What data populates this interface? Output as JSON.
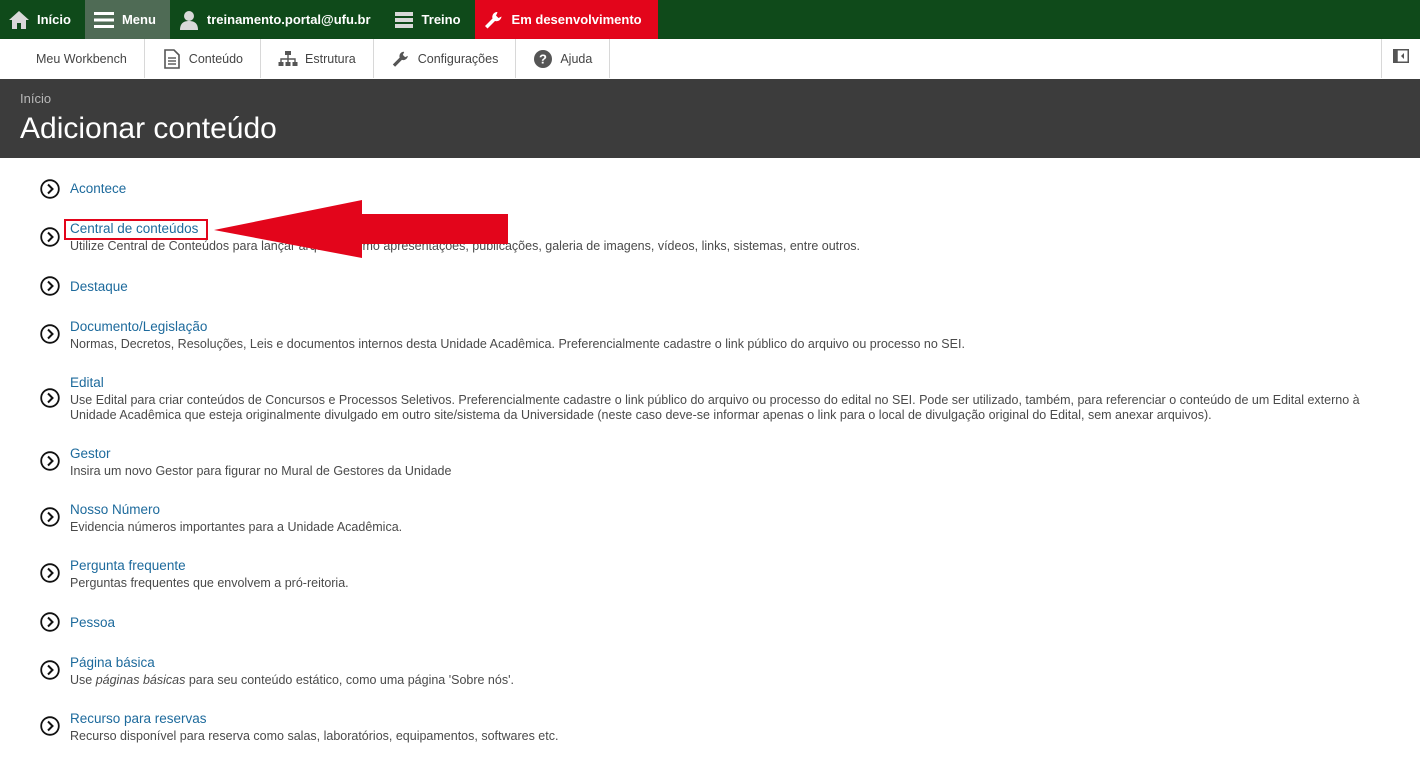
{
  "toolbar": {
    "home": "Início",
    "menu": "Menu",
    "user": "treinamento.portal@ufu.br",
    "treino": "Treino",
    "dev": "Em desenvolvimento"
  },
  "tray": {
    "workbench": "Meu Workbench",
    "content": "Conteúdo",
    "structure": "Estrutura",
    "config": "Configurações",
    "help": "Ajuda"
  },
  "header": {
    "breadcrumb": "Início",
    "title": "Adicionar conteúdo"
  },
  "items": [
    {
      "label": "Acontece",
      "desc": ""
    },
    {
      "label": "Central de conteúdos",
      "desc": "Utilize Central de Conteúdos para lançar arquivos como apresentações, publicações, galeria de imagens, vídeos, links, sistemas, entre outros."
    },
    {
      "label": "Destaque",
      "desc": ""
    },
    {
      "label": "Documento/Legislação",
      "desc": "Normas, Decretos, Resoluções, Leis e documentos internos desta Unidade Acadêmica. Preferencialmente cadastre o link público do arquivo ou processo no SEI."
    },
    {
      "label": "Edital",
      "desc": "Use Edital para criar conteúdos de Concursos e Processos Seletivos. Preferencialmente cadastre o link público do arquivo ou processo do edital no SEI. Pode ser utilizado, também, para referenciar o conteúdo de um Edital externo à Unidade Acadêmica que esteja originalmente divulgado em outro site/sistema da Universidade (neste caso deve-se informar apenas o link para o local de divulgação original do Edital, sem anexar arquivos)."
    },
    {
      "label": "Gestor",
      "desc": "Insira um novo Gestor para figurar no Mural de Gestores da Unidade"
    },
    {
      "label": "Nosso Número",
      "desc": "Evidencia números importantes para a Unidade Acadêmica."
    },
    {
      "label": "Pergunta frequente",
      "desc": "Perguntas frequentes que envolvem a pró-reitoria."
    },
    {
      "label": "Pessoa",
      "desc": ""
    },
    {
      "label": "Página básica",
      "desc_pre": "Use ",
      "desc_em": "páginas básicas",
      "desc_post": " para seu conteúdo estático, como uma página 'Sobre nós'."
    },
    {
      "label": "Recurso para reservas",
      "desc": "Recurso disponível para reserva como salas, laboratórios, equipamentos, softwares etc."
    }
  ],
  "colors": {
    "toolbar_bg": "#0f4a1a",
    "dev_bg": "#e3051b",
    "header_bg": "#3c3c3c",
    "link": "#1d6a9c",
    "annotation": "#e3051b"
  }
}
